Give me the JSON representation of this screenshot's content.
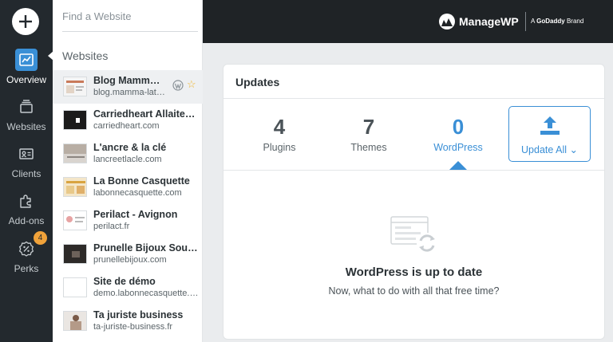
{
  "nav": {
    "add_icon": "plus-icon",
    "items": [
      {
        "label": "Overview",
        "icon": "chart-icon",
        "active": true
      },
      {
        "label": "Websites",
        "icon": "stack-icon"
      },
      {
        "label": "Clients",
        "icon": "id-card-icon"
      },
      {
        "label": "Add-ons",
        "icon": "puzzle-icon"
      },
      {
        "label": "Perks",
        "icon": "percent-icon",
        "badge": "4"
      }
    ]
  },
  "panel": {
    "search_placeholder": "Find a Website",
    "heading": "Websites",
    "sites": [
      {
        "name": "Blog Mamma Latte",
        "url": "blog.mamma-latte.com",
        "selected": true
      },
      {
        "name": "Carriedheart Allaitement",
        "url": "carriedheart.com"
      },
      {
        "name": "L'ancre & la clé",
        "url": "lancreetlacle.com"
      },
      {
        "name": "La Bonne Casquette",
        "url": "labonnecasquette.com"
      },
      {
        "name": "Perilact - Avignon",
        "url": "perilact.fr"
      },
      {
        "name": "Prunelle Bijoux Souvenirs",
        "url": "prunellebijoux.com"
      },
      {
        "name": "Site de démo",
        "url": "demo.labonnecasquette.com"
      },
      {
        "name": "Ta juriste business",
        "url": "ta-juriste-business.fr"
      }
    ]
  },
  "topbar": {
    "brand_name": "ManageWP",
    "brand_prefix": "A",
    "brand_company": "GoDaddy",
    "brand_suffix": "Brand"
  },
  "updates": {
    "title": "Updates",
    "stats": [
      {
        "value": "4",
        "label": "Plugins"
      },
      {
        "value": "7",
        "label": "Themes"
      },
      {
        "value": "0",
        "label": "WordPress",
        "active": true
      }
    ],
    "update_all_label": "Update All ⌄",
    "empty_title": "WordPress is up to date",
    "empty_subtitle": "Now, what to do with all that free time?"
  },
  "colors": {
    "accent": "#3a8fd6",
    "nav_bg": "#23292e",
    "topbar_bg": "#1f2326",
    "badge": "#f0a23a",
    "star": "#f0b429"
  }
}
